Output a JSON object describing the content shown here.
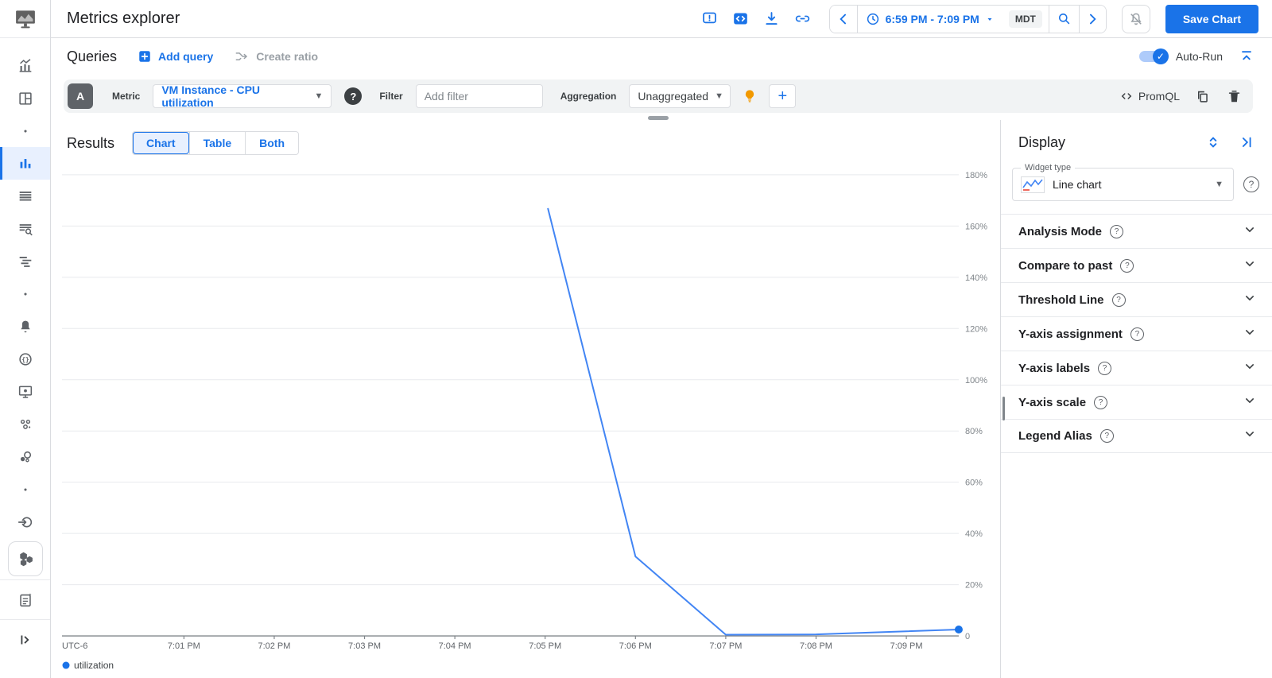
{
  "colors": {
    "accent": "#1a73e8",
    "chart_line": "#4285f4",
    "active_item_bg": "#e8f0fe"
  },
  "sidebar": {
    "items": [
      {
        "icon": "trend-chart"
      },
      {
        "icon": "dashboards"
      },
      {
        "icon": "dot"
      },
      {
        "icon": "metrics-explorer",
        "active": true
      },
      {
        "icon": "list"
      },
      {
        "icon": "logs-search"
      },
      {
        "icon": "trace"
      },
      {
        "icon": "dot"
      },
      {
        "icon": "alerting-bell"
      },
      {
        "icon": "releases"
      },
      {
        "icon": "vm-monitor"
      },
      {
        "icon": "groups"
      },
      {
        "icon": "services"
      },
      {
        "icon": "dot"
      },
      {
        "icon": "integrations"
      },
      {
        "icon": "kubernetes-hexagons",
        "boxed": true
      },
      {
        "icon": "report-doc",
        "divider": true
      },
      {
        "icon": "expand-panel",
        "divider": true
      }
    ]
  },
  "header": {
    "title": "Metrics explorer",
    "action_icons": [
      "feedback",
      "code-embed",
      "download",
      "link"
    ],
    "time_range": "6:59 PM - 7:09 PM",
    "timezone": "MDT",
    "save_button": "Save Chart"
  },
  "queries": {
    "title": "Queries",
    "add_query": "Add query",
    "create_ratio": "Create ratio",
    "auto_run": "Auto-Run"
  },
  "query_builder": {
    "query_letter": "A",
    "metric_label": "Metric",
    "metric_value": "VM Instance - CPU utilization",
    "filter_label": "Filter",
    "filter_placeholder": "Add filter",
    "aggregation_label": "Aggregation",
    "aggregation_value": "Unaggregated",
    "promql_label": "PromQL"
  },
  "results": {
    "title": "Results",
    "tabs": [
      {
        "label": "Chart",
        "selected": true
      },
      {
        "label": "Table",
        "selected": false
      },
      {
        "label": "Both",
        "selected": false
      }
    ]
  },
  "display_panel": {
    "title": "Display",
    "widget_type_label": "Widget type",
    "widget_type_value": "Line chart",
    "sections": [
      "Analysis Mode",
      "Compare to past",
      "Threshold Line",
      "Y-axis assignment",
      "Y-axis labels",
      "Y-axis scale",
      "Legend Alias"
    ]
  },
  "chart_data": {
    "type": "line",
    "title": "",
    "xlabel": "",
    "ylabel": "",
    "timezone_label": "UTC-6",
    "x_range_minutes_after_7pm": [
      -0.35,
      9.58
    ],
    "y_range": [
      0,
      180
    ],
    "grid": true,
    "x_ticks": [
      {
        "t": 1,
        "label": "7:01 PM"
      },
      {
        "t": 2,
        "label": "7:02 PM"
      },
      {
        "t": 3,
        "label": "7:03 PM"
      },
      {
        "t": 4,
        "label": "7:04 PM"
      },
      {
        "t": 5,
        "label": "7:05 PM"
      },
      {
        "t": 6,
        "label": "7:06 PM"
      },
      {
        "t": 7,
        "label": "7:07 PM"
      },
      {
        "t": 8,
        "label": "7:08 PM"
      },
      {
        "t": 9,
        "label": "7:09 PM"
      }
    ],
    "y_ticks": [
      {
        "v": 180,
        "label": "180%"
      },
      {
        "v": 160,
        "label": "160%"
      },
      {
        "v": 140,
        "label": "140%"
      },
      {
        "v": 120,
        "label": "120%"
      },
      {
        "v": 100,
        "label": "100%"
      },
      {
        "v": 80,
        "label": "80%"
      },
      {
        "v": 60,
        "label": "60%"
      },
      {
        "v": 40,
        "label": "40%"
      },
      {
        "v": 20,
        "label": "20%"
      },
      {
        "v": 0,
        "label": "0"
      }
    ],
    "series": [
      {
        "name": "utilization",
        "color": "#4285f4",
        "points": [
          {
            "t": 5.03,
            "v": 167
          },
          {
            "t": 6.0,
            "v": 31
          },
          {
            "t": 7.0,
            "v": 0.5
          },
          {
            "t": 8.0,
            "v": 0.6
          },
          {
            "t": 9.58,
            "v": 2.5
          }
        ]
      }
    ],
    "legend": [
      {
        "label": "utilization",
        "color": "#1a73e8"
      }
    ]
  }
}
